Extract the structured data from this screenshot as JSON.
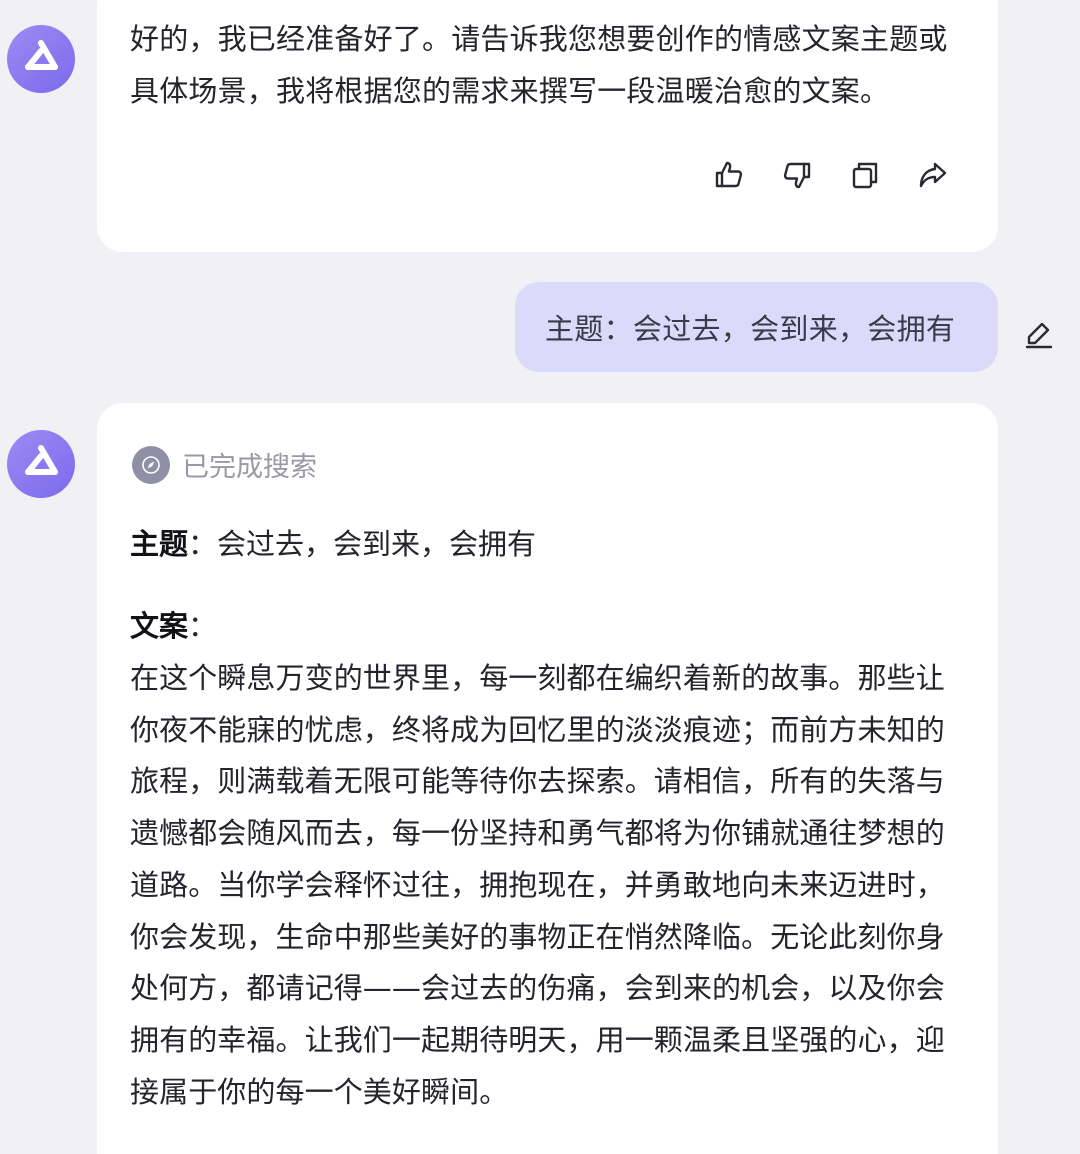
{
  "colors": {
    "background": "#f1f1f5",
    "ai_bubble": "#ffffff",
    "user_bubble": "#dcdafb",
    "avatar_accent": "#8a78f0",
    "muted_text": "#9898a6"
  },
  "messages": {
    "ai_first": {
      "text": "好的，我已经准备好了。请告诉我您想要创作的情感文案主题或具体场景，我将根据您的需求来撰写一段温暖治愈的文案。",
      "actions": [
        "thumbs-up-icon",
        "thumbs-down-icon",
        "copy-icon",
        "share-icon"
      ]
    },
    "user": {
      "text": "主题：会过去，会到来，会拥有",
      "edit_icon": "pencil-icon"
    },
    "ai_second": {
      "search_status": "已完成搜索",
      "topic_label": "主题",
      "topic_sep": "：",
      "topic_value": "会过去，会到来，会拥有",
      "copy_label": "文案",
      "copy_sep": "：",
      "copy_body": "在这个瞬息万变的世界里，每一刻都在编织着新的故事。那些让你夜不能寐的忧虑，终将成为回忆里的淡淡痕迹；而前方未知的旅程，则满载着无限可能等待你去探索。请相信，所有的失落与遗憾都会随风而去，每一份坚持和勇气都将为你铺就通往梦想的道路。当你学会释怀过往，拥抱现在，并勇敢地向未来迈进时，你会发现，生命中那些美好的事物正在悄然降临。无论此刻你身处何方，都请记得——会过去的伤痛，会到来的机会，以及你会拥有的幸福。让我们一起期待明天，用一颗温柔且坚强的心，迎接属于你的每一个美好瞬间。"
    }
  }
}
